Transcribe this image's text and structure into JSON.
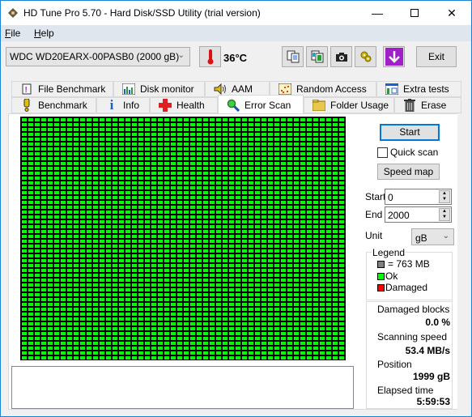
{
  "window": {
    "title": "HD Tune Pro 5.70 - Hard Disk/SSD Utility (trial version)",
    "controls": [
      "minimize",
      "maximize",
      "close"
    ]
  },
  "menu": {
    "items": [
      {
        "label": "File",
        "accel": "F"
      },
      {
        "label": "Help",
        "accel": "H"
      }
    ]
  },
  "toolbar": {
    "drive": "WDC WD20EARX-00PASB0 (2000 gB)",
    "temperature": "36°C",
    "buttons": [
      "copy-text-icon",
      "copy-screenshot-icon",
      "camera-icon",
      "options-icon",
      "save-icon"
    ],
    "exit_label": "Exit"
  },
  "tabs": {
    "row1": [
      {
        "label": "File Benchmark",
        "icon": "file-benchmark-icon"
      },
      {
        "label": "Disk monitor",
        "icon": "disk-monitor-icon"
      },
      {
        "label": "AAM",
        "icon": "speaker-icon"
      },
      {
        "label": "Random Access",
        "icon": "random-access-icon"
      },
      {
        "label": "Extra tests",
        "icon": "extra-tests-icon"
      }
    ],
    "row2": [
      {
        "label": "Benchmark",
        "icon": "benchmark-icon"
      },
      {
        "label": "Info",
        "icon": "info-icon"
      },
      {
        "label": "Health",
        "icon": "health-icon"
      },
      {
        "label": "Error Scan",
        "icon": "magnifier-icon",
        "active": true
      },
      {
        "label": "Folder Usage",
        "icon": "folder-icon"
      },
      {
        "label": "Erase",
        "icon": "trash-icon"
      }
    ]
  },
  "scan": {
    "grid": {
      "columns": 50,
      "rows": 50,
      "ok_color": "#00ff00",
      "damaged_color": "#ff0000",
      "block_color": "#808080",
      "damaged_blocks": 0
    },
    "log_text": ""
  },
  "controls": {
    "start_label": "Start",
    "quick_scan_label": "Quick scan",
    "quick_scan_checked": false,
    "speed_map_label": "Speed map",
    "start_field_label": "Start",
    "start_value": "0",
    "end_field_label": "End",
    "end_value": "2000",
    "unit_label": "Unit",
    "unit_value": "gB"
  },
  "legend": {
    "title": "Legend",
    "items": [
      {
        "label": "= 763 MB",
        "color": "#808080"
      },
      {
        "label": "Ok",
        "color": "#00ff00"
      },
      {
        "label": "Damaged",
        "color": "#ff0000"
      }
    ]
  },
  "stats": {
    "damaged_blocks_label": "Damaged blocks",
    "damaged_blocks_value": "0.0 %",
    "scanning_speed_label": "Scanning speed",
    "scanning_speed_value": "53.4 MB/s",
    "position_label": "Position",
    "position_value": "1999 gB",
    "elapsed_label": "Elapsed time",
    "elapsed_value": "5:59:53"
  }
}
